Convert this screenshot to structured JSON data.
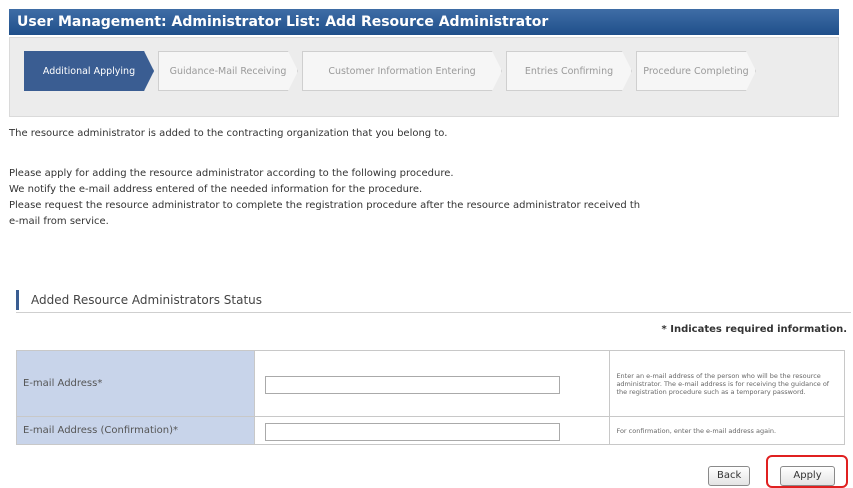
{
  "header": {
    "title": "User Management: Administrator List: Add Resource Administrator"
  },
  "steps": [
    {
      "label": "Additional Applying",
      "active": true
    },
    {
      "label": "Guidance-Mail Receiving",
      "active": false
    },
    {
      "label": "Customer Information Entering",
      "active": false
    },
    {
      "label": "Entries Confirming",
      "active": false
    },
    {
      "label": "Procedure Completing",
      "active": false
    }
  ],
  "intro": {
    "line1": "The resource administrator is added to the contracting organization that you belong to.",
    "line2": "Please apply for adding the resource administrator according to the following procedure.",
    "line3": "We notify the e-mail address entered of the needed information for the procedure.",
    "line4": "Please request the resource administrator to complete the registration procedure after the resource administrator received th",
    "line5": "e-mail from service."
  },
  "section": {
    "title": "Added Resource Administrators Status",
    "required_note": "* Indicates required information."
  },
  "form": {
    "rows": [
      {
        "label": "E-mail Address*",
        "value": "",
        "help": "Enter an e-mail address of the person who will be the resource administrator. The e-mail address is for receiving the guidance of the registration procedure such as a temporary password."
      },
      {
        "label": "E-mail Address (Confirmation)*",
        "value": "",
        "help": "For confirmation, enter the e-mail address again."
      }
    ]
  },
  "buttons": {
    "back": "Back",
    "apply": "Apply"
  },
  "colors": {
    "header": "#2a5792",
    "active_step": "#3a5d92",
    "label_bg": "#c8d4ea",
    "highlight": "#e02020"
  }
}
